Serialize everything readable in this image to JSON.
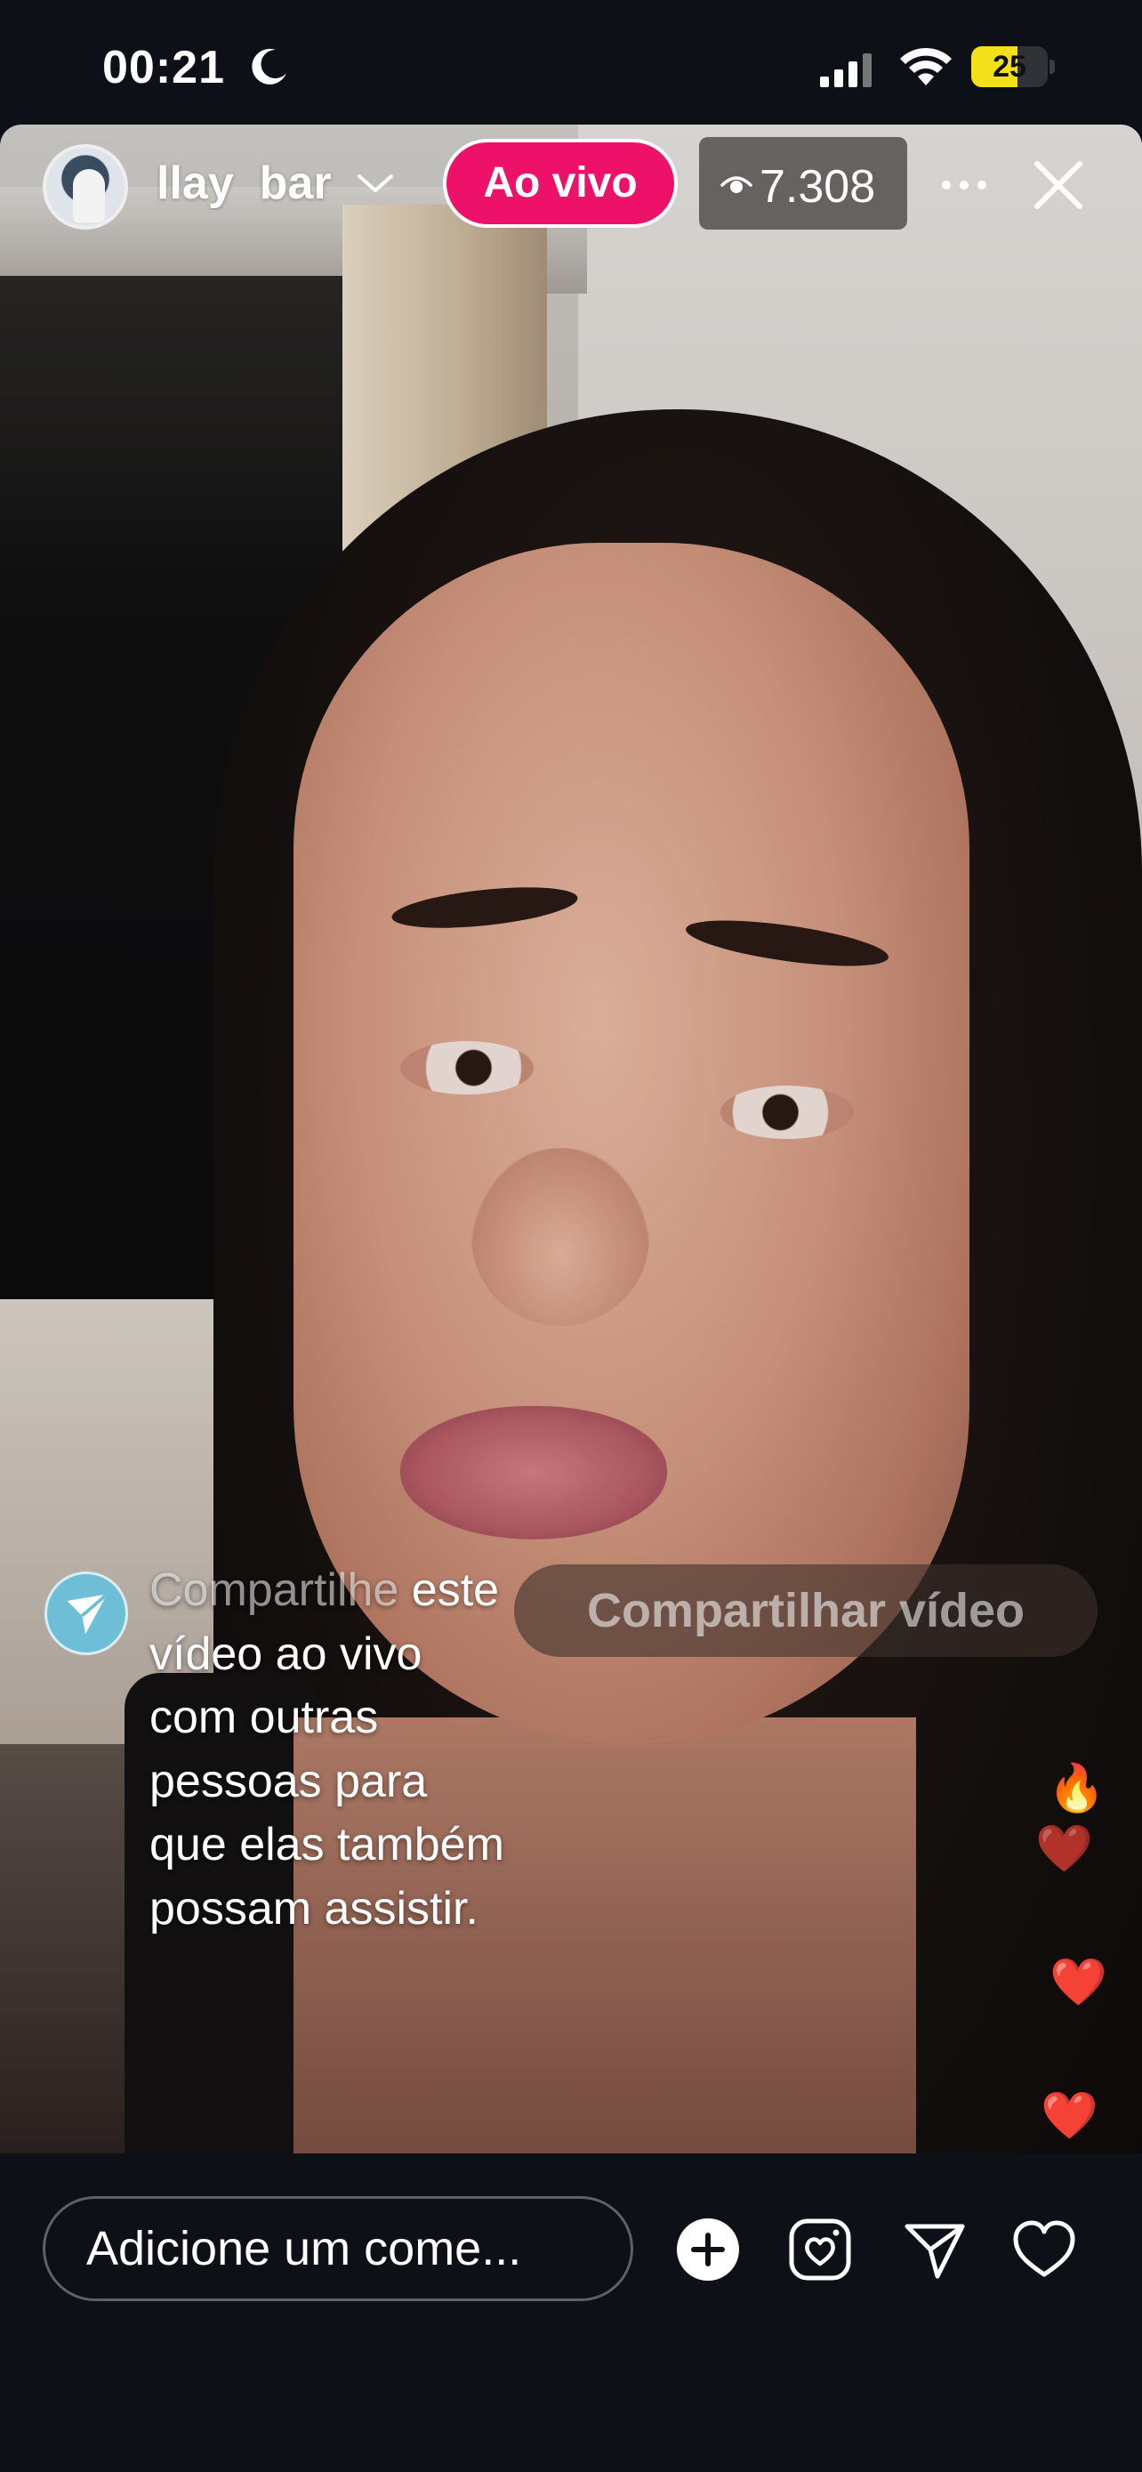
{
  "status_bar": {
    "time": "00:21",
    "battery_level": "25",
    "battery_fraction": 0.25,
    "icons": [
      "moon-icon",
      "signal-icon",
      "wifi-icon",
      "battery-icon"
    ]
  },
  "live_header": {
    "username": "llay  bar",
    "live_label": "Ao vivo",
    "viewer_count": "7.308",
    "icons": [
      "avatar",
      "chevron-down-icon",
      "eye-icon",
      "more-icon",
      "close-icon"
    ]
  },
  "share_prompt": {
    "text_faded": "Compartilhe",
    "text": "este vídeo ao vivo com outras pessoas para que elas também possam assistir.",
    "button_label": "Compartilhar vídeo"
  },
  "reactions": [
    "🔥",
    "❤️",
    "❤️",
    "❤️"
  ],
  "bottom_bar": {
    "comment_placeholder": "Adicione um come...",
    "icons": [
      "add-icon",
      "instagram-icon",
      "send-icon",
      "heart-icon"
    ]
  },
  "colors": {
    "live_badge": "#ee1169",
    "battery": "#f2e11a",
    "background": "#0d1117",
    "share_icon": "#6dbed6"
  }
}
